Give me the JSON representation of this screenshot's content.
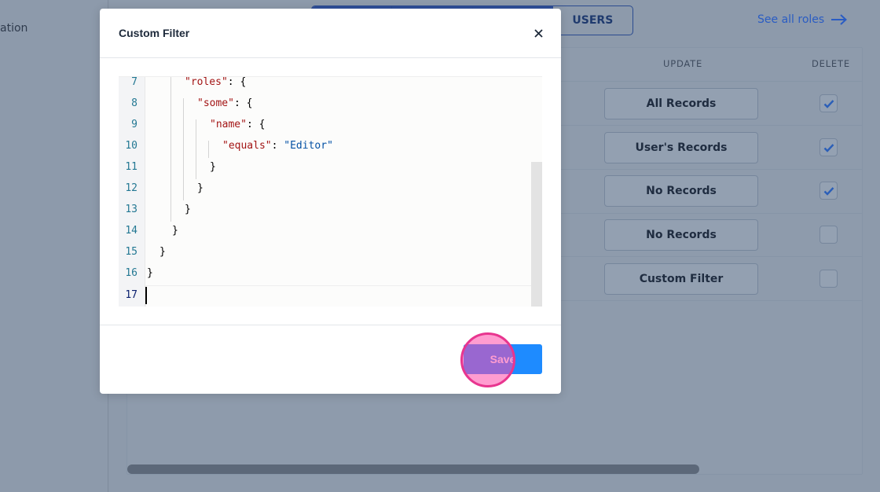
{
  "background": {
    "sidebar_partial_text": "ation",
    "tabs": [
      "",
      "",
      "",
      "USERS"
    ],
    "see_all_roles": "See all roles",
    "columns": {
      "update": "UPDATE",
      "delete": "DELETE"
    },
    "rows": [
      {
        "update": "All Records",
        "delete_checked": true
      },
      {
        "update": "User's Records",
        "delete_checked": true
      },
      {
        "update": "No Records",
        "delete_checked": true
      },
      {
        "update": "No Records",
        "delete_checked": false
      },
      {
        "update": "Custom Filter",
        "delete_checked": false
      }
    ]
  },
  "modal": {
    "title": "Custom Filter",
    "close_icon": "close-icon",
    "editor": {
      "lines": [
        {
          "num": "7",
          "key": "\"roles\"",
          "rest": ": {"
        },
        {
          "num": "8",
          "key": "\"some\"",
          "rest": ": {"
        },
        {
          "num": "9",
          "key": "\"name\"",
          "rest": ": {"
        },
        {
          "num": "10",
          "key": "\"equals\"",
          "rest": ": ",
          "value": "\"Editor\""
        },
        {
          "num": "11",
          "text": "}"
        },
        {
          "num": "12",
          "text": "}"
        },
        {
          "num": "13",
          "text": "}"
        },
        {
          "num": "14",
          "text": "}"
        },
        {
          "num": "15",
          "text": "}"
        },
        {
          "num": "16",
          "text": "}"
        },
        {
          "num": "17",
          "text": ""
        }
      ]
    },
    "save_label": "Save"
  },
  "colors": {
    "accent": "#1e8bff",
    "overlay": "#8b98a9",
    "json_key": "#a31515",
    "json_string": "#0451a5",
    "line_number": "#237893",
    "click_marker": "#e8358f"
  }
}
